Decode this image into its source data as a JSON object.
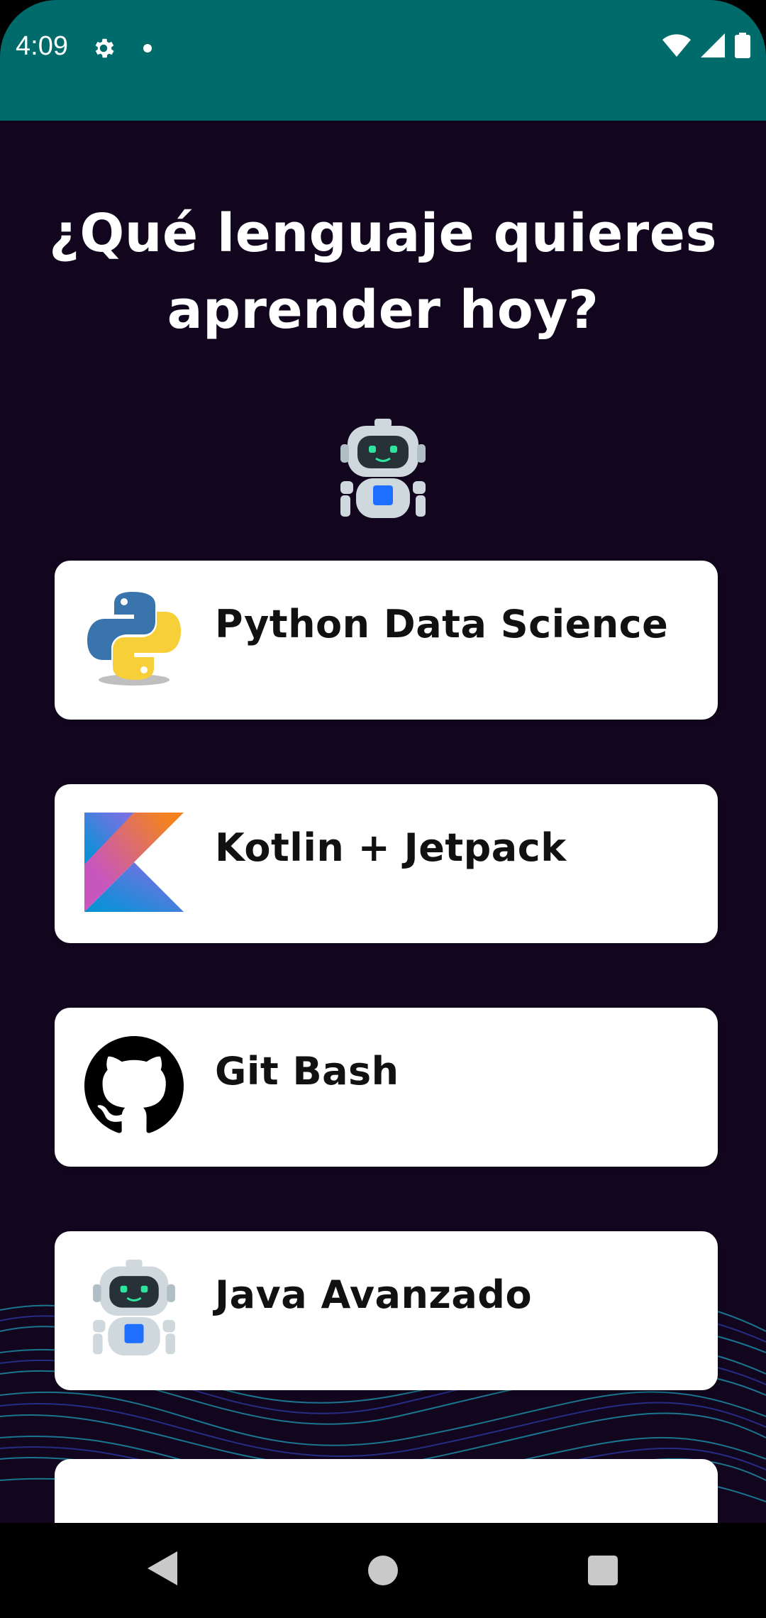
{
  "status_bar": {
    "time": "4:09",
    "icons": [
      "gear-icon",
      "notification-dot-icon",
      "wifi-icon",
      "cell-signal-icon",
      "battery-icon"
    ],
    "background": "#006b6b"
  },
  "page": {
    "title": "¿Qué lenguaje quieres aprender hoy?",
    "background": "#12061e",
    "header_icon": "robot-icon"
  },
  "courses": [
    {
      "label": "Python Data Science",
      "icon": "python-logo-icon"
    },
    {
      "label": "Kotlin + Jetpack",
      "icon": "kotlin-logo-icon"
    },
    {
      "label": "Git Bash",
      "icon": "github-logo-icon"
    },
    {
      "label": "Java Avanzado",
      "icon": "robot-icon"
    }
  ],
  "nav_bar": {
    "icons": [
      "back-icon",
      "home-icon",
      "recent-apps-icon"
    ]
  }
}
